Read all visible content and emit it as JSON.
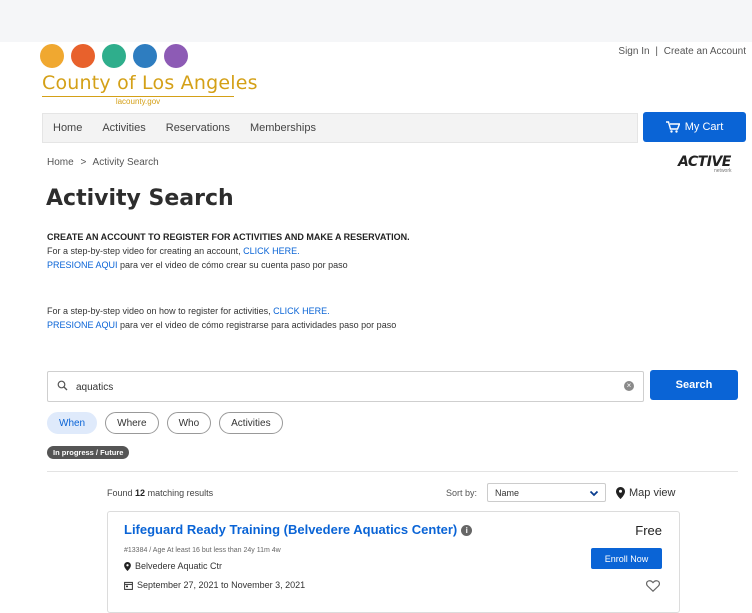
{
  "header": {
    "logo_text": "County of Los Angeles",
    "logo_subtext": "lacounty.gov",
    "sign_in": "Sign In",
    "separator": "|",
    "create_account": "Create an Account"
  },
  "nav": {
    "items": [
      "Home",
      "Activities",
      "Reservations",
      "Memberships"
    ],
    "cart_label": "My Cart"
  },
  "breadcrumb": {
    "home": "Home",
    "separator": ">",
    "current": "Activity Search"
  },
  "active_logo": {
    "text": "ACTIVE",
    "sub": "network"
  },
  "page_title": "Activity Search",
  "info": {
    "heading": "CREATE AN ACCOUNT TO REGISTER FOR ACTIVITIES AND MAKE A RESERVATION.",
    "line1_text": "For a step-by-step video for creating an account,",
    "line1_link": "CLICK HERE.",
    "line2_link": "PRESIONE AQUI",
    "line2_text": "para ver el video de cómo crear su cuenta paso por paso",
    "line3_text": "For a step-by-step video on how to register for activities,",
    "line3_link": "CLICK HERE.",
    "line4_link": "PRESIONE AQUI",
    "line4_text": "para ver el video de cómo registrarse para actividades paso por paso"
  },
  "search": {
    "value": "aquatics",
    "button": "Search"
  },
  "filters": [
    "When",
    "Where",
    "Who",
    "Activities"
  ],
  "active_filter_tag": "In progress / Future",
  "results": {
    "found_prefix": "Found",
    "count": "12",
    "found_suffix": "matching results",
    "sort_label": "Sort by:",
    "sort_value": "Name",
    "map_view": "Map view"
  },
  "card": {
    "title": "Lifeguard Ready Training (Belvedere Aquatics Center)",
    "meta": "#13384 / Age At least 16 but less than 24y 11m 4w",
    "location": "Belvedere Aquatic Ctr",
    "dates": "September 27, 2021 to November 3, 2021",
    "price": "Free",
    "enroll": "Enroll Now"
  },
  "colors": {
    "primary": "#0a64d6",
    "logo_gold": "#d4a017"
  }
}
